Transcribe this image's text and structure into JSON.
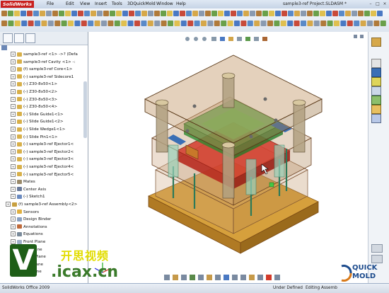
{
  "app": {
    "name": "SolidWorks",
    "window_title": "sample3-ref Project.SLDASM *"
  },
  "menu": [
    "File",
    "Edit",
    "View",
    "Insert",
    "Tools",
    "3DQuickMold",
    "Window",
    "Help"
  ],
  "tree": [
    {
      "label": "sample3-ref <1> ->? (Defa",
      "icon": "part-icon",
      "depth": 1
    },
    {
      "label": "sample3-ref Cavity <1> -:",
      "icon": "part-icon",
      "depth": 1
    },
    {
      "label": "(f) sample3-ref Core<1>",
      "icon": "part-icon",
      "depth": 1
    },
    {
      "label": "(-) sample3-ref Sidecore1",
      "icon": "part-icon",
      "depth": 1
    },
    {
      "label": "(-) Z30-8x50<1>",
      "icon": "part-icon",
      "depth": 1
    },
    {
      "label": "(-) Z30-8x50<2>",
      "icon": "part-icon",
      "depth": 1
    },
    {
      "label": "(-) Z30-8x50<3>",
      "icon": "part-icon",
      "depth": 1
    },
    {
      "label": "(-) Z30-8x50<4>",
      "icon": "part-icon",
      "depth": 1
    },
    {
      "label": "(-) Slide Guide1<1>",
      "icon": "part-icon",
      "depth": 1
    },
    {
      "label": "(-) Slide Guide1<2>",
      "icon": "part-icon",
      "depth": 1
    },
    {
      "label": "(-) Slide Wedge1<1>",
      "icon": "part-icon",
      "depth": 1
    },
    {
      "label": "(-) Slide Pin1<1>",
      "icon": "part-icon",
      "depth": 1
    },
    {
      "label": "(-) sample3-ref Ejector1<",
      "icon": "part-icon",
      "depth": 1
    },
    {
      "label": "(-) sample3-ref Ejector2<",
      "icon": "part-icon",
      "depth": 1
    },
    {
      "label": "(-) sample3-ref Ejector3<",
      "icon": "part-icon",
      "depth": 1
    },
    {
      "label": "(-) sample3-ref Ejector4<",
      "icon": "part-icon",
      "depth": 1
    },
    {
      "label": "(-) sample3-ref Ejector5<",
      "icon": "part-icon",
      "depth": 1
    },
    {
      "label": "Mates",
      "icon": "mates-icon",
      "depth": 1
    },
    {
      "label": "Center Axis",
      "icon": "axis-icon",
      "depth": 1
    },
    {
      "label": "(-) Sketch1",
      "icon": "sketch-icon",
      "depth": 1
    },
    {
      "label": "(f) sample3-ref Assembly<2>",
      "icon": "assembly-icon",
      "depth": 0
    },
    {
      "label": "Sensors",
      "icon": "sensor-icon",
      "depth": 1
    },
    {
      "label": "Design Binder",
      "icon": "binder-icon",
      "depth": 1
    },
    {
      "label": "Annotations",
      "icon": "annotation-icon",
      "depth": 1
    },
    {
      "label": "Equations",
      "icon": "equation-icon",
      "depth": 1
    },
    {
      "label": "Front Plane",
      "icon": "plane-icon",
      "depth": 1
    },
    {
      "label": "Top Plane",
      "icon": "plane-icon",
      "depth": 1
    },
    {
      "label": "Right Plane",
      "icon": "plane-icon",
      "depth": 1
    },
    {
      "label": "ting Plane",
      "icon": "plane-icon",
      "depth": 1
    },
    {
      "label": "ion Plane",
      "icon": "plane-icon",
      "depth": 1
    }
  ],
  "status": {
    "app_version": "SolidWorks Office 2009",
    "state": "Under Defined",
    "mode": "Editing Assemb"
  },
  "watermark": {
    "letter": "V",
    "chinese": "开思视频",
    "url": ".icax.cn"
  },
  "quickmold": {
    "line1": "QUICK",
    "line2": "MOLD"
  },
  "colors": {
    "brand": "#c9201e",
    "accent": "#3a6fb5",
    "wood": "#c8922f",
    "green_insert": "#3fa040",
    "red_core": "#d23a2a"
  }
}
